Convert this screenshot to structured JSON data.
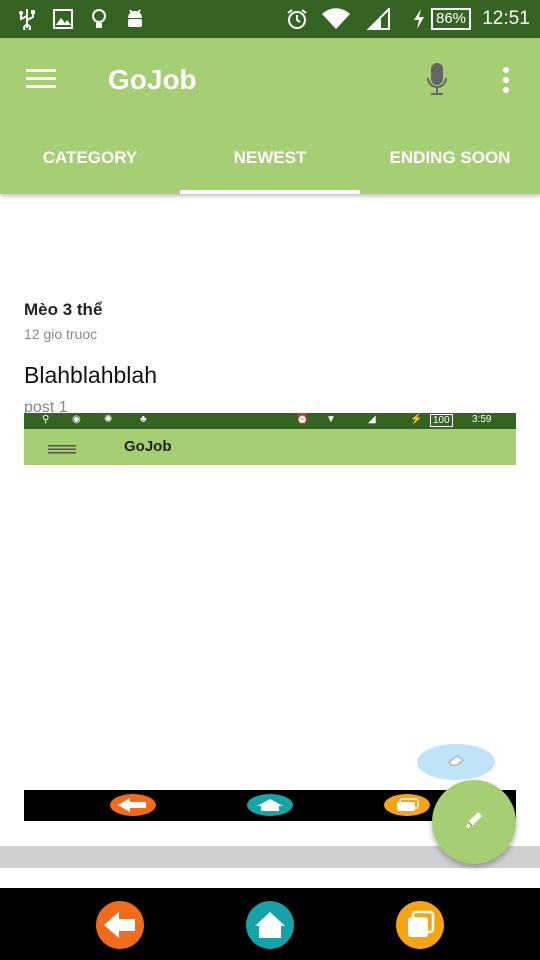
{
  "status_bar": {
    "battery": "86%",
    "time": "12:51",
    "icons": [
      "usb-icon",
      "image-icon",
      "bulb-icon",
      "android-icon",
      "alarm-icon",
      "wifi-icon",
      "signal-icon",
      "charging-icon",
      "battery-icon"
    ]
  },
  "app_bar": {
    "title": "GoJob",
    "menu_icon": "menu-icon",
    "mic_icon": "mic-icon",
    "overflow_icon": "more-vert-icon"
  },
  "tabs": [
    {
      "label": "CATEGORY",
      "selected": false
    },
    {
      "label": "NEWEST",
      "selected": true
    },
    {
      "label": "ENDING SOON",
      "selected": false
    }
  ],
  "post": {
    "author": "Mèo 3 thể",
    "time": "12 gio truoc",
    "title": "Blahblahblah",
    "subtitle": "post 1"
  },
  "embedded_screenshot": {
    "battery": "100",
    "time": "3:59",
    "title": "GoJob"
  },
  "fab": {
    "icon": "pencil-icon"
  },
  "mini_fab": {
    "icon": "eraser-icon"
  },
  "nav_bar": {
    "icons": [
      "back-icon",
      "home-icon",
      "recents-icon"
    ]
  },
  "colors": {
    "status_bar": "#356422",
    "app_bar": "#a5cf72",
    "nav_back": "#f26a1b",
    "nav_home": "#15a3a8",
    "nav_recents": "#f7a414"
  }
}
